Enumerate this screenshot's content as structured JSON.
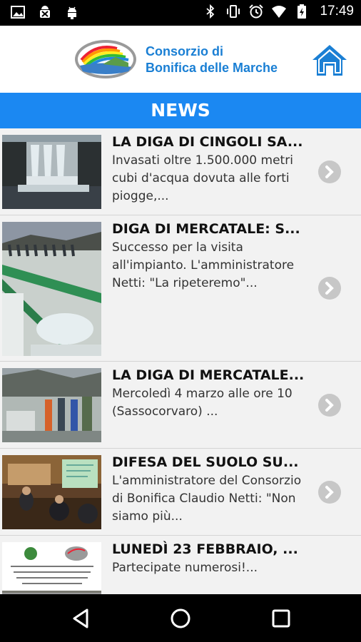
{
  "status_bar": {
    "time": "17:49",
    "left_icons": [
      "image-icon",
      "android-bug-icon",
      "android-icon"
    ],
    "right_icons": [
      "bluetooth-icon",
      "vibrate-icon",
      "alarm-icon",
      "wifi-icon",
      "battery-charging-icon"
    ]
  },
  "header": {
    "brand_line1": "Consorzio di",
    "brand_line2": "Bonifica delle Marche",
    "logo_icon": "consorzio-logo-icon",
    "home_icon": "home-icon"
  },
  "news_bar": {
    "label": "NEWS"
  },
  "news": [
    {
      "title": "LA DIGA DI CINGOLI SA...",
      "desc": "Invasati oltre 1.500.000 metri cubi d'acqua dovuta alle forti piogge,..."
    },
    {
      "title": "DIGA DI MERCATALE: S...",
      "desc": "Successo per la visita all'impianto. L'amministratore Netti: \"La ripeteremo\"..."
    },
    {
      "title": "LA DIGA DI MERCATALE...",
      "desc": "Mercoledì 4 marzo alle ore 10 (Sassocorvaro) ..."
    },
    {
      "title": "DIFESA DEL SUOLO SU...",
      "desc": "L'amministratore del Consorzio di Bonifica Claudio Netti: \"Non siamo più..."
    },
    {
      "title": "LUNEDÌ 23 FEBBRAIO, ...",
      "desc": "Partecipate numerosi!..."
    }
  ],
  "colors": {
    "accent": "#1b88f2",
    "brand_text": "#1a7fd4",
    "status_bar": "#000000",
    "list_bg": "#f2f2f2"
  },
  "nav": {
    "back_icon": "back-icon",
    "home_icon": "home-circle-icon",
    "recents_icon": "recents-icon"
  }
}
